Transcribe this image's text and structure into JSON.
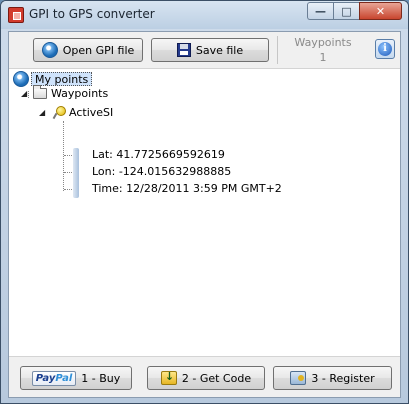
{
  "window": {
    "title": "GPI to GPS converter",
    "minimize_glyph": "—",
    "maximize_glyph": "□",
    "close_glyph": "✕"
  },
  "toolbar": {
    "open_label": "Open GPI file",
    "save_label": "Save file",
    "waypoints_label": "Waypoints",
    "waypoints_count": "1",
    "info_glyph": "i"
  },
  "tree": {
    "root_label": "My points",
    "folder_label": "Waypoints",
    "waypoint": {
      "name": "ActiveSI",
      "lat": "Lat: 41.7725669592619",
      "lon": "Lon: -124.015632988885",
      "time": "Time: 12/28/2011 3:59 PM GMT+2"
    }
  },
  "bottom": {
    "buy_label": "1 - Buy",
    "paypal_pay": "Pay",
    "paypal_pal": "Pal",
    "code_label": "2 - Get Code",
    "register_label": "3 - Register"
  },
  "icons": {
    "app": "app-icon",
    "open": "globe-icon",
    "save": "floppy-icon",
    "info": "info-icon",
    "root": "globe-icon",
    "folder": "folder-icon",
    "waypoint": "pushpin-icon",
    "code": "download-code-icon",
    "register": "register-icon"
  },
  "colors": {
    "selection_bg": "#cfe3fb",
    "disabled_text": "#8a8a8a",
    "close_button": "#c8452e"
  }
}
